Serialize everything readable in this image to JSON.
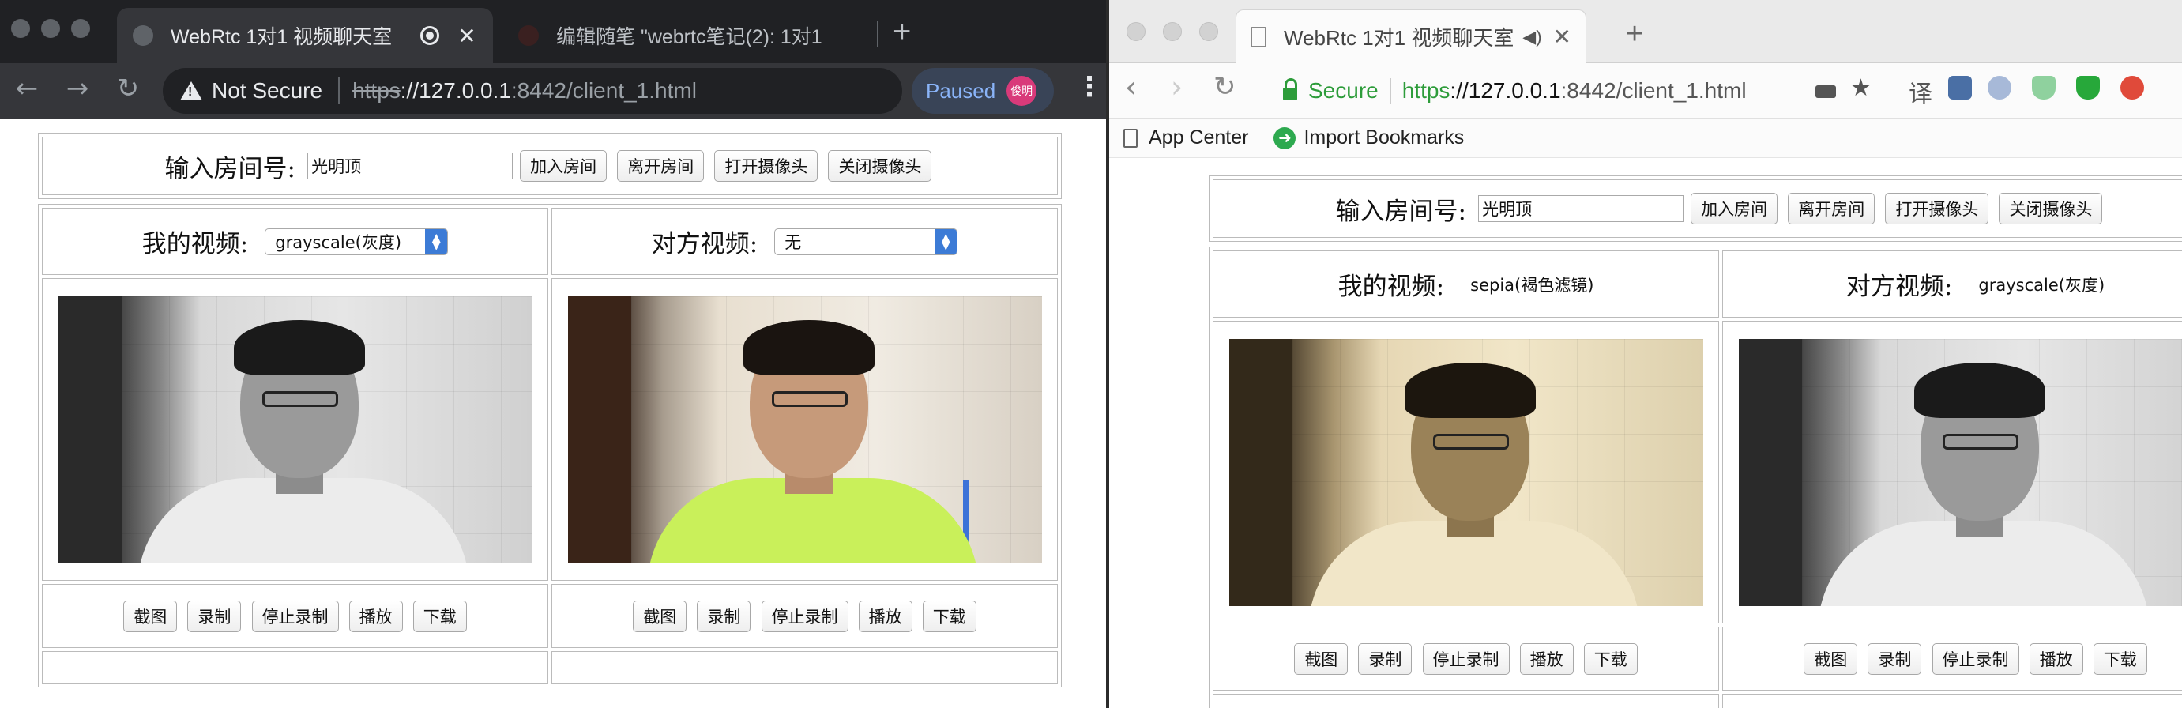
{
  "chrome": {
    "active_tab_title": "WebRtc 1对1 视频聊天室",
    "inactive_tab_title": "编辑随笔 \"webrtc笔记(2): 1对1",
    "omnibox": {
      "security_label": "Not Secure",
      "url_scheme": "https",
      "url_host": "://127.0.0.1",
      "url_rest": ":8442/client_1.html"
    },
    "profile_state": "Paused",
    "profile_avatar_text": "俊明"
  },
  "safari": {
    "tab_title": "WebRtc 1对1 视频聊天室",
    "security_label": "Secure",
    "url_scheme": "https",
    "url_host": "://127.0.0.1",
    "url_rest": ":8442/client_1.html",
    "toolbar_translate_label": "译",
    "bookmarks": [
      {
        "label": "App Center"
      },
      {
        "label": "Import Bookmarks"
      }
    ]
  },
  "page_left": {
    "room_label": "输入房间号:",
    "room_value": "光明顶",
    "room_buttons": [
      "加入房间",
      "离开房间",
      "打开摄像头",
      "关闭摄像头"
    ],
    "my_video_label": "我的视频:",
    "my_filter_value": "grayscale(灰度)",
    "peer_video_label": "对方视频:",
    "peer_filter_value": "无",
    "action_buttons": [
      "截图",
      "录制",
      "停止录制",
      "播放",
      "下载"
    ]
  },
  "page_right": {
    "room_label": "输入房间号:",
    "room_value": "光明顶",
    "room_buttons": [
      "加入房间",
      "离开房间",
      "打开摄像头",
      "关闭摄像头"
    ],
    "my_video_label": "我的视频:",
    "my_filter_value": "sepia(褐色滤镜)",
    "peer_video_label": "对方视频:",
    "peer_filter_value": "grayscale(灰度)",
    "action_buttons": [
      "截图",
      "录制",
      "停止录制",
      "播放",
      "下载"
    ]
  },
  "colors": {
    "chrome_frame": "#202124",
    "chrome_toolbar": "#35363a",
    "safari_secure_green": "#2d9c3a",
    "select_arrow_blue": "#3c7bd6"
  }
}
